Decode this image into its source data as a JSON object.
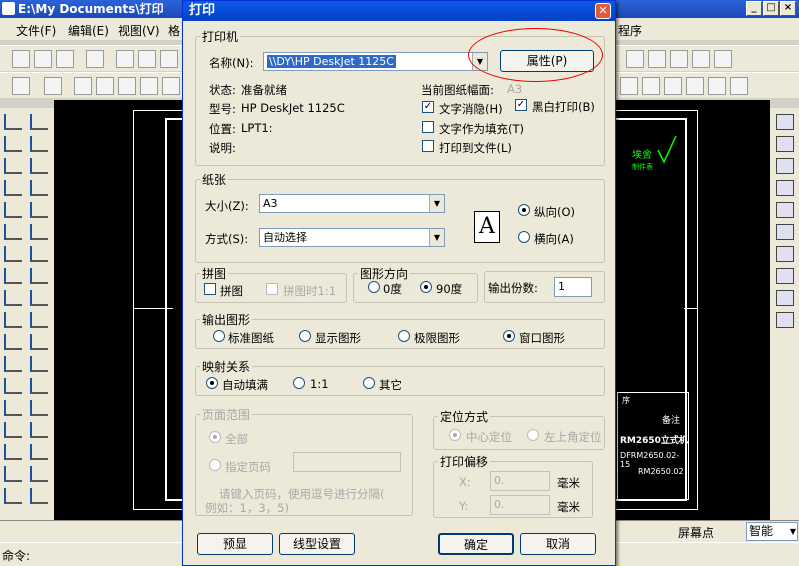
{
  "app": {
    "title": "E:\\My Documents\\打印",
    "menu": [
      "文件(F)",
      "编辑(E)",
      "视图(V)",
      "格"
    ],
    "menu_right": "程序"
  },
  "status": {
    "command_label": "命令:",
    "screen_point": "屏幕点",
    "smart": "智能"
  },
  "drawing": {
    "stamp": "埃舍",
    "stamp2": "制件表",
    "title1": "RM2650立式机",
    "title2": "DFRM2650.02-15",
    "title3": "RM2650.02",
    "row1": "序",
    "row2": "备注"
  },
  "dialog": {
    "title": "打印",
    "printer": {
      "legend": "打印机",
      "name_label": "名称(N):",
      "name_value": "\\\\DY\\HP DeskJet 1125C",
      "props_button": "属性(P)",
      "status_label": "状态:",
      "status_value": "准备就绪",
      "type_label": "型号:",
      "type_value": "HP DeskJet 1125C",
      "location_label": "位置:",
      "location_value": "LPT1:",
      "comment_label": "说明:",
      "current_size_label": "当前图纸幅面:",
      "current_size_value": "A3",
      "opt_erase": "文字消隐(H)",
      "opt_bw": "黑白打印(B)",
      "opt_fill": "文字作为填充(T)",
      "opt_file": "打印到文件(L)"
    },
    "paper": {
      "legend": "纸张",
      "size_label": "大小(Z):",
      "size_value": "A3",
      "mode_label": "方式(S):",
      "mode_value": "自动选择",
      "icon_letter": "A",
      "portrait": "纵向(O)",
      "landscape": "横向(A)"
    },
    "tile": {
      "legend": "拼图",
      "tile": "拼图",
      "tile_1": "拼图时1:1"
    },
    "orient": {
      "legend": "图形方向",
      "deg0": "0度",
      "deg90": "90度"
    },
    "copies": {
      "label": "输出份数:",
      "value": "1"
    },
    "output": {
      "legend": "输出图形",
      "std": "标准图纸",
      "display": "显示图形",
      "extent": "极限图形",
      "window": "窗口图形"
    },
    "mapping": {
      "legend": "映射关系",
      "auto": "自动填满",
      "one": "1:1",
      "other": "其它"
    },
    "range": {
      "legend": "页面范围",
      "all": "全部",
      "pages": "指定页码",
      "hint1": "请键入页码，使用逗号进行分隔(",
      "hint2": "例如：1，3，5)"
    },
    "position": {
      "legend": "定位方式",
      "center": "中心定位",
      "topleft": "左上角定位"
    },
    "offset": {
      "legend": "打印偏移",
      "x_label": "X:",
      "x_value": "0.",
      "y_label": "Y:",
      "y_value": "0.",
      "unit": "毫米"
    },
    "buttons": {
      "preview": "预显",
      "linetype": "线型设置",
      "ok": "确定",
      "cancel": "取消"
    }
  }
}
